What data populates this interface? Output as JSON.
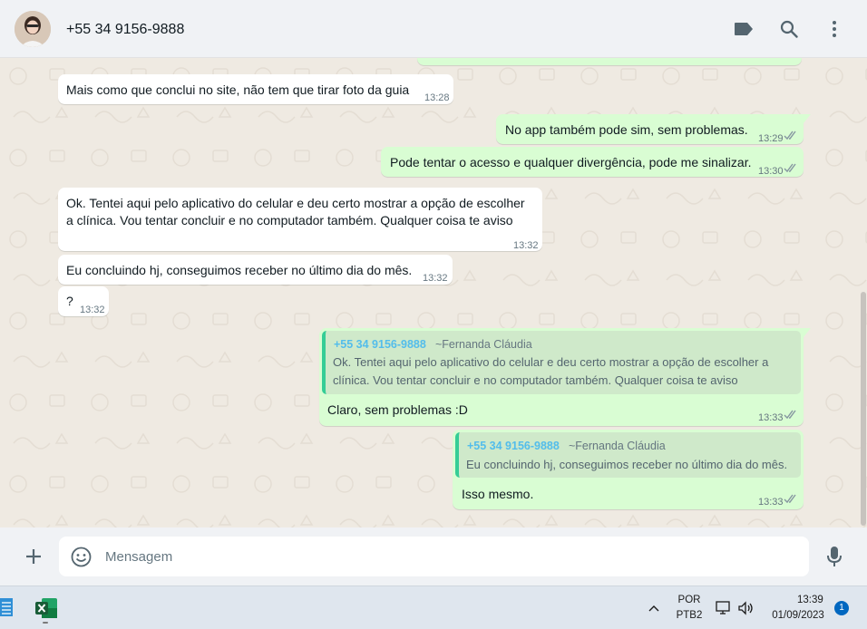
{
  "header": {
    "contact_name": "+55 34 9156-9888",
    "icons": [
      "label-icon",
      "search-icon",
      "menu-icon"
    ]
  },
  "messages": [
    {
      "dir": "in",
      "text": "Mais como que conclui no site, não tem que tirar foto da guia",
      "time": "13:28"
    },
    {
      "dir": "out",
      "text": "No app também pode sim, sem problemas.",
      "time": "13:29",
      "status": "read"
    },
    {
      "dir": "out",
      "text": "Pode tentar o acesso e qualquer divergência, pode me sinalizar.",
      "time": "13:30",
      "status": "read"
    },
    {
      "dir": "in",
      "text_lines": [
        "Ok. Tentei aqui pelo aplicativo do celular e deu certo mostrar a opção de escolher",
        "a clínica. Vou tentar concluir e no computador também. Qualquer coisa te aviso"
      ],
      "time": "13:32"
    },
    {
      "dir": "in",
      "text": "Eu concluindo hj, conseguimos receber no último dia do mês.",
      "time": "13:32"
    },
    {
      "dir": "in",
      "text": "?",
      "time": "13:32"
    },
    {
      "dir": "out",
      "quote": {
        "author": "+55 34 9156-9888",
        "pushname": "~Fernanda Cláudia",
        "text_lines": [
          "Ok. Tentei aqui pelo aplicativo do celular e deu certo mostrar a opção de escolher a",
          "clínica. Vou tentar concluir e no computador também. Qualquer coisa te aviso"
        ]
      },
      "text": "Claro, sem problemas :D",
      "time": "13:33",
      "status": "read"
    },
    {
      "dir": "out",
      "quote": {
        "author": "+55 34 9156-9888",
        "pushname": "~Fernanda Cláudia",
        "text": "Eu concluindo hj, conseguimos receber no último dia do mês."
      },
      "text": "Isso mesmo.",
      "time": "13:33",
      "status": "read"
    }
  ],
  "composer": {
    "placeholder": "Mensagem",
    "icons": [
      "plus-icon",
      "emoji-icon",
      "mic-icon"
    ]
  },
  "taskbar": {
    "lang_top": "POR",
    "lang_bottom": "PTB2",
    "clock_time": "13:39",
    "clock_date": "01/09/2023",
    "notification_count": "1"
  },
  "colors": {
    "incoming": "#ffffff",
    "outgoing": "#d9fdd3",
    "chat_bg": "#efeae2",
    "quote_author": "#53bdeb",
    "read_ticks": "#8696a0"
  }
}
